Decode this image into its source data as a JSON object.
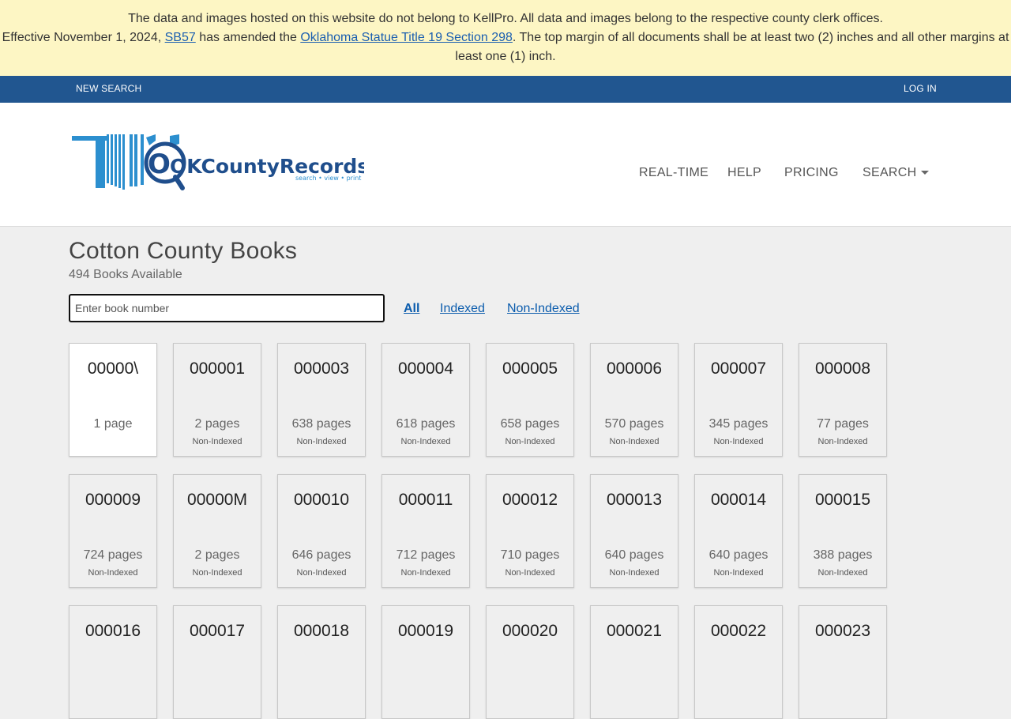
{
  "notice": {
    "line1": "The data and images hosted on this website do not belong to KellPro. All data and images belong to the respective county clerk offices.",
    "line2_prefix": "Effective November 1, 2024, ",
    "sb_link": "SB57",
    "line2_mid": " has amended the ",
    "statute_link": "Oklahoma Statue Title 19 Section 298",
    "line2_suffix": ". The top margin of all documents shall be at least two (2) inches and all other margins at least one (1) inch."
  },
  "topbar": {
    "new_search": "NEW SEARCH",
    "log_in": "LOG IN"
  },
  "header": {
    "logo_text": "OKCountyRecords.com",
    "logo_tagline": "search • view • print",
    "nav": {
      "realtime": "REAL-TIME",
      "help": "HELP",
      "pricing": "PRICING",
      "search": "SEARCH"
    }
  },
  "colors": {
    "banner": "#fdf6c4",
    "topbar": "#215690",
    "link": "#0b5cad",
    "logo_blue": "#2c8fcf",
    "logo_dark": "#1f4e8c"
  },
  "main": {
    "title": "Cotton County Books",
    "count": "494 Books Available",
    "search_placeholder": "Enter book number",
    "filters": {
      "all": "All",
      "indexed": "Indexed",
      "non_indexed": "Non-Indexed"
    },
    "books": [
      {
        "number": "00000\\",
        "pages": "1 page",
        "status": ""
      },
      {
        "number": "000001",
        "pages": "2 pages",
        "status": "Non-Indexed"
      },
      {
        "number": "000003",
        "pages": "638 pages",
        "status": "Non-Indexed"
      },
      {
        "number": "000004",
        "pages": "618 pages",
        "status": "Non-Indexed"
      },
      {
        "number": "000005",
        "pages": "658 pages",
        "status": "Non-Indexed"
      },
      {
        "number": "000006",
        "pages": "570 pages",
        "status": "Non-Indexed"
      },
      {
        "number": "000007",
        "pages": "345 pages",
        "status": "Non-Indexed"
      },
      {
        "number": "000008",
        "pages": "77 pages",
        "status": "Non-Indexed"
      },
      {
        "number": "000009",
        "pages": "724 pages",
        "status": "Non-Indexed"
      },
      {
        "number": "00000M",
        "pages": "2 pages",
        "status": "Non-Indexed"
      },
      {
        "number": "000010",
        "pages": "646 pages",
        "status": "Non-Indexed"
      },
      {
        "number": "000011",
        "pages": "712 pages",
        "status": "Non-Indexed"
      },
      {
        "number": "000012",
        "pages": "710 pages",
        "status": "Non-Indexed"
      },
      {
        "number": "000013",
        "pages": "640 pages",
        "status": "Non-Indexed"
      },
      {
        "number": "000014",
        "pages": "640 pages",
        "status": "Non-Indexed"
      },
      {
        "number": "000015",
        "pages": "388 pages",
        "status": "Non-Indexed"
      },
      {
        "number": "000016",
        "pages": "",
        "status": ""
      },
      {
        "number": "000017",
        "pages": "",
        "status": ""
      },
      {
        "number": "000018",
        "pages": "",
        "status": ""
      },
      {
        "number": "000019",
        "pages": "",
        "status": ""
      },
      {
        "number": "000020",
        "pages": "",
        "status": ""
      },
      {
        "number": "000021",
        "pages": "",
        "status": ""
      },
      {
        "number": "000022",
        "pages": "",
        "status": ""
      },
      {
        "number": "000023",
        "pages": "",
        "status": ""
      }
    ]
  }
}
